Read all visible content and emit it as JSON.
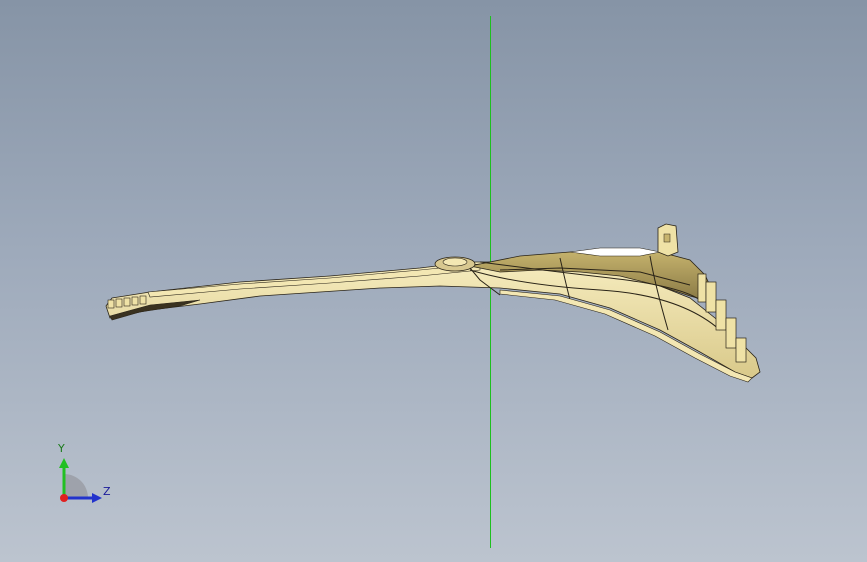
{
  "viewport": {
    "background_top": "#8694a6",
    "background_bottom": "#bcc4cf",
    "part_color": "#efe2a6",
    "edge_color": "#2a2418",
    "reference_axis_color": "#1ec01e"
  },
  "triad": {
    "y_label": "Y",
    "z_label": "Z",
    "y_color": "#22c022",
    "z_color": "#2233cc",
    "x_color": "#e02020"
  }
}
